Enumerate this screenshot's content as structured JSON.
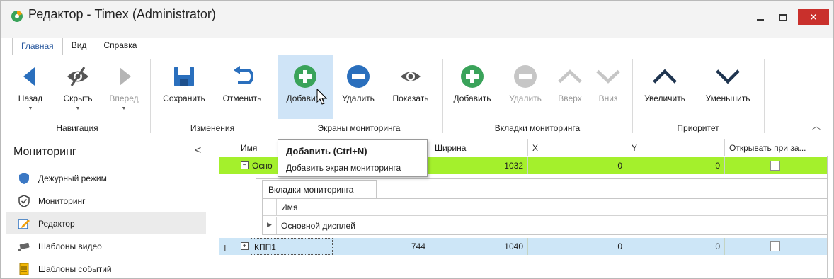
{
  "window": {
    "title": "Редактор - Timex (Administrator)",
    "close_glyph": "✕",
    "colors": {
      "close": "#c9302c",
      "accent_tab": "#2b5a9f",
      "row_green": "#a4f02c",
      "row_blue": "#cde6f7",
      "icon_blue": "#2a6fbd",
      "icon_green": "#3aa35a",
      "icon_dark": "#1f3550"
    }
  },
  "menu": {
    "tabs": [
      "Главная",
      "Вид",
      "Справка"
    ],
    "active": "Главная"
  },
  "ribbon": {
    "navigation": {
      "label": "Навигация",
      "back": "Назад",
      "hide": "Скрыть",
      "forward": "Вперед"
    },
    "changes": {
      "label": "Изменения",
      "save": "Сохранить",
      "cancel": "Отменить"
    },
    "screens": {
      "label": "Экраны мониторинга",
      "add": "Добавить",
      "delete": "Удалить",
      "show": "Показать"
    },
    "tabs_group": {
      "label": "Вкладки мониторинга",
      "add": "Добавить",
      "delete": "Удалить",
      "up": "Вверх",
      "down": "Вниз"
    },
    "priority": {
      "label": "Приоритет",
      "increase": "Увеличить",
      "decrease": "Уменьшить"
    }
  },
  "tooltip": {
    "title": "Добавить (Ctrl+N)",
    "description": "Добавить экран мониторинга"
  },
  "nav": {
    "title": "Мониторинг",
    "collapse_glyph": "<",
    "items": [
      {
        "label": "Дежурный режим",
        "icon": "shield-icon"
      },
      {
        "label": "Мониторинг",
        "icon": "shield-check-icon"
      },
      {
        "label": "Редактор",
        "icon": "edit-icon",
        "selected": true
      },
      {
        "label": "Шаблоны видео",
        "icon": "camera-icon"
      },
      {
        "label": "Шаблоны событий",
        "icon": "document-icon"
      }
    ]
  },
  "grid": {
    "columns": [
      "Имя",
      "Ширина",
      "X",
      "Y",
      "Открывать при за..."
    ],
    "rows": [
      {
        "name": "Осно",
        "height": "",
        "width": "1032",
        "x": "0",
        "y": "0",
        "expander": "−"
      },
      {
        "name": "КПП1",
        "height": "744",
        "width": "1040",
        "x": "0",
        "y": "0",
        "expander": "+"
      }
    ],
    "detail": {
      "tab": "Вкладки мониторинга",
      "column": "Имя",
      "rows": [
        "Основной дисплей"
      ]
    },
    "row_indicator": "I"
  }
}
